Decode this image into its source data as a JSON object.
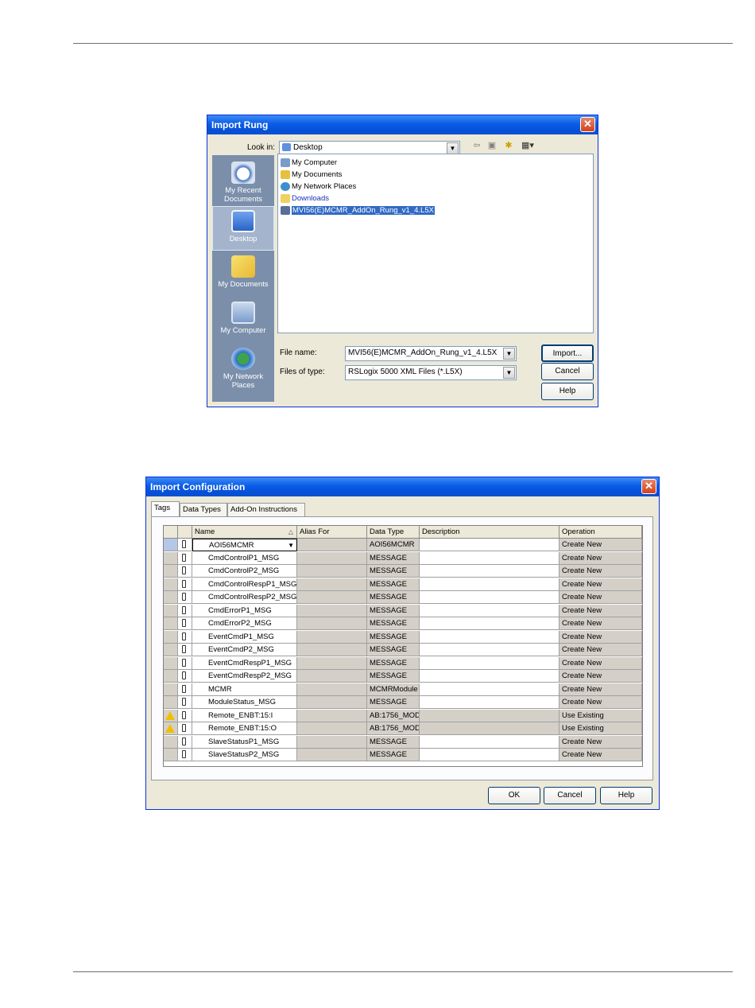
{
  "import_rung": {
    "title": "Import Rung",
    "look_in_label": "Look in:",
    "look_in_value": "Desktop",
    "places": [
      {
        "label": "My Recent Documents",
        "icon": "recent-documents-icon"
      },
      {
        "label": "Desktop",
        "icon": "desktop-icon"
      },
      {
        "label": "My Documents",
        "icon": "my-documents-icon"
      },
      {
        "label": "My Computer",
        "icon": "my-computer-icon"
      },
      {
        "label": "My Network Places",
        "icon": "network-places-icon"
      }
    ],
    "files": [
      {
        "name": "My Computer",
        "icon": "computer-icon"
      },
      {
        "name": "My Documents",
        "icon": "folder-documents-icon"
      },
      {
        "name": "My Network Places",
        "icon": "network-icon"
      },
      {
        "name": "Downloads",
        "icon": "folder-icon"
      },
      {
        "name": "MVI56(E)MCMR_AddOn_Rung_v1_4.L5X",
        "icon": "l5x-file-icon",
        "selected": true
      }
    ],
    "file_name_label": "File name:",
    "file_name_value": "MVI56(E)MCMR_AddOn_Rung_v1_4.L5X",
    "file_type_label": "Files of type:",
    "file_type_value": "RSLogix 5000 XML Files (*.L5X)",
    "buttons": {
      "import": "Import...",
      "cancel": "Cancel",
      "help": "Help"
    }
  },
  "import_config": {
    "title": "Import Configuration",
    "tabs": [
      "Tags",
      "Data Types",
      "Add-On Instructions"
    ],
    "columns": [
      "Name",
      "Alias For",
      "Data Type",
      "Description",
      "Operation"
    ],
    "rows": [
      {
        "name": "AOI56MCMR",
        "alias": "",
        "type": "AOI56MCMR",
        "desc": "",
        "op": "Create New",
        "warn": false
      },
      {
        "name": "CmdControlP1_MSG",
        "alias": "",
        "type": "MESSAGE",
        "desc": "",
        "op": "Create New",
        "warn": false
      },
      {
        "name": "CmdControlP2_MSG",
        "alias": "",
        "type": "MESSAGE",
        "desc": "",
        "op": "Create New",
        "warn": false
      },
      {
        "name": "CmdControlRespP1_MSG",
        "alias": "",
        "type": "MESSAGE",
        "desc": "",
        "op": "Create New",
        "warn": false
      },
      {
        "name": "CmdControlRespP2_MSG",
        "alias": "",
        "type": "MESSAGE",
        "desc": "",
        "op": "Create New",
        "warn": false
      },
      {
        "name": "CmdErrorP1_MSG",
        "alias": "",
        "type": "MESSAGE",
        "desc": "",
        "op": "Create New",
        "warn": false
      },
      {
        "name": "CmdErrorP2_MSG",
        "alias": "",
        "type": "MESSAGE",
        "desc": "",
        "op": "Create New",
        "warn": false
      },
      {
        "name": "EventCmdP1_MSG",
        "alias": "",
        "type": "MESSAGE",
        "desc": "",
        "op": "Create New",
        "warn": false
      },
      {
        "name": "EventCmdP2_MSG",
        "alias": "",
        "type": "MESSAGE",
        "desc": "",
        "op": "Create New",
        "warn": false
      },
      {
        "name": "EventCmdRespP1_MSG",
        "alias": "",
        "type": "MESSAGE",
        "desc": "",
        "op": "Create New",
        "warn": false
      },
      {
        "name": "EventCmdRespP2_MSG",
        "alias": "",
        "type": "MESSAGE",
        "desc": "",
        "op": "Create New",
        "warn": false
      },
      {
        "name": "MCMR",
        "alias": "",
        "type": "MCMRModule",
        "desc": "",
        "op": "Create New",
        "warn": false
      },
      {
        "name": "ModuleStatus_MSG",
        "alias": "",
        "type": "MESSAGE",
        "desc": "",
        "op": "Create New",
        "warn": false
      },
      {
        "name": "Remote_ENBT:15:I",
        "alias": "",
        "type": "AB:1756_MOD",
        "desc": "",
        "op": "Use Existing",
        "warn": true
      },
      {
        "name": "Remote_ENBT:15:O",
        "alias": "",
        "type": "AB:1756_MOD",
        "desc": "",
        "op": "Use Existing",
        "warn": true
      },
      {
        "name": "SlaveStatusP1_MSG",
        "alias": "",
        "type": "MESSAGE",
        "desc": "",
        "op": "Create New",
        "warn": false
      },
      {
        "name": "SlaveStatusP2_MSG",
        "alias": "",
        "type": "MESSAGE",
        "desc": "",
        "op": "Create New",
        "warn": false
      }
    ],
    "buttons": {
      "ok": "OK",
      "cancel": "Cancel",
      "help": "Help"
    }
  }
}
